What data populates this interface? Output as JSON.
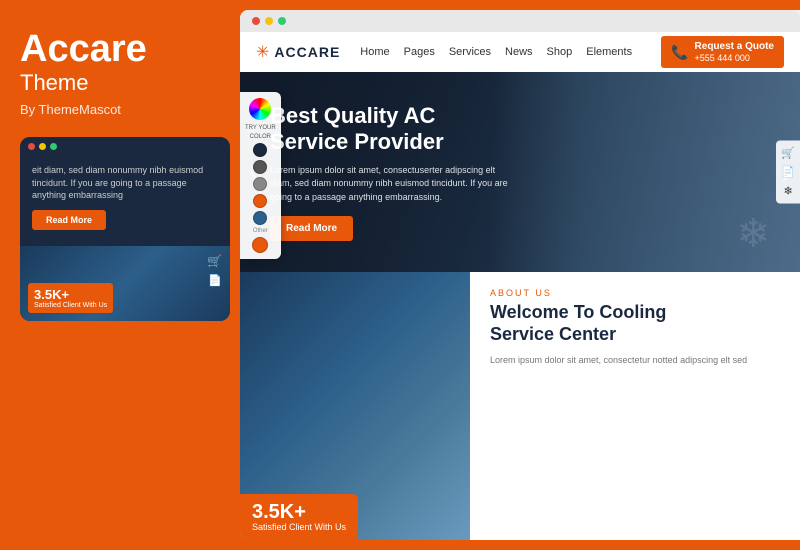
{
  "left": {
    "brand": {
      "title": "Accare",
      "subtitle": "Theme",
      "by": "By ThemeMascot"
    },
    "mobile": {
      "dots": [
        "red",
        "yellow",
        "green"
      ],
      "body_text": "eit diam, sed diam nonummy nibh euismod tincidunt. If you are going to a passage anything embarrassing",
      "read_more": "Read More",
      "badge_number": "3.5K+",
      "badge_text": "Satisfied Client With Us"
    }
  },
  "browser": {
    "dots": [
      "red",
      "yellow",
      "green"
    ]
  },
  "navbar": {
    "logo_text": "ACCARE",
    "links": [
      "Home",
      "Pages",
      "Services",
      "News",
      "Shop",
      "Elements"
    ],
    "cta_text": "Request a Quote",
    "cta_phone": "+555 444 000"
  },
  "hero": {
    "title": "Best Quality AC\nService Provider",
    "description": "Lorem ipsum dolor sit amet, consectuserter adipscing elt diam, sed diam nonummy nibh euismod tincidunt. If you are going to a passage anything embarrassing.",
    "read_more": "Read More",
    "arrow_left": "❮",
    "arrow_right": "❯",
    "snowflake": "❄"
  },
  "color_picker": {
    "try_label": "TRY YOUR",
    "color_label": "COLOR",
    "other_label": "Other",
    "swatches": [
      "#1a2940",
      "#555",
      "#888",
      "#e8580a",
      "#2c5f8a",
      "#fff"
    ]
  },
  "about": {
    "label": "ABOUT US",
    "title": "Welcome To Cooling\nService Center",
    "description": "Lorem ipsum dolor sit amet, consectetur notted adipscing elt sed"
  },
  "bottom": {
    "badge_number": "3.5K+",
    "badge_text": "Satisfied Client With Us"
  }
}
